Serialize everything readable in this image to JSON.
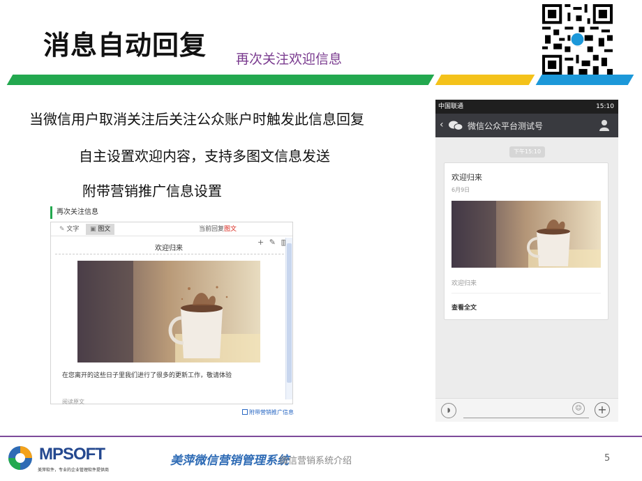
{
  "header": {
    "title": "消息自动回复",
    "subtitle": "再次关注欢迎信息"
  },
  "bullets": {
    "line1": "当微信用户取消关注后关注公众账户时触发此信息回复",
    "line2": "自主设置欢迎内容，支持多图文信息发送",
    "line3": "附带营销推广信息设置"
  },
  "editor": {
    "section_title": "再次关注信息",
    "tab_text": "文字",
    "tab_image": "图文",
    "current_reply_prefix": "当前回复",
    "current_reply_value": "图文",
    "tools": "+ ✎ 🗑",
    "message_title": "欢迎归来",
    "description": "在您离开的这些日子里我们进行了很多的更新工作，敬请体验",
    "read_more": "阅读原文",
    "promo_checkbox_label": "附带营销推广信息"
  },
  "phone": {
    "carrier": "中国联通",
    "time": "15:10",
    "account_name": "微信公众平台测试号",
    "time_chip": "下午15:10",
    "card": {
      "title": "欢迎归来",
      "date": "6月9日",
      "digest": "欢迎归来",
      "read_all": "查看全文"
    }
  },
  "footer": {
    "logo_name": "MPSOFT",
    "logo_tagline": "美萍软件，专业的企业管理软件提供商",
    "brand_text": "美萍微信营销管理系统",
    "center_text": "微信营销系统介绍",
    "page_number": "5"
  },
  "colors": {
    "bar_green": "#23a84f",
    "bar_yellow": "#f4c21a",
    "bar_blue": "#1c98d9",
    "subtitle_purple": "#7a3b8f",
    "footer_line": "#7d4a9a",
    "brand_blue": "#2e6bb5"
  }
}
